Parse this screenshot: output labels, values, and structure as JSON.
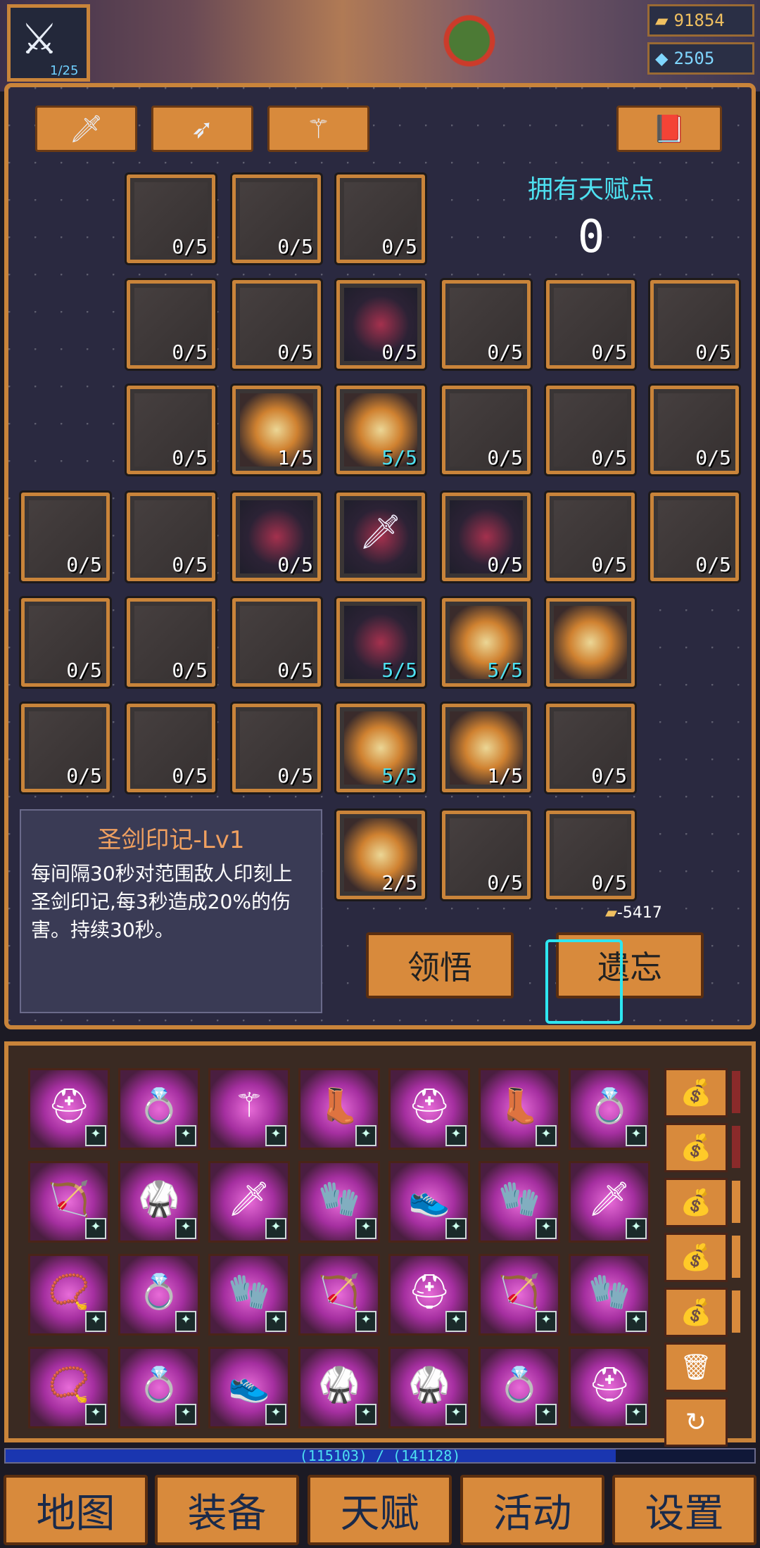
{
  "header": {
    "level_text": "1/25",
    "gold": "91854",
    "gems": "2505",
    "icons": {
      "gold": "gold-bars-icon",
      "gem": "diamond-icon",
      "avatar": "sword-avatar-icon",
      "boss": "boss-portrait-icon"
    }
  },
  "talent": {
    "weapon_tabs": [
      {
        "name": "sword-tab",
        "icon": "sword-icon"
      },
      {
        "name": "bow-tab",
        "icon": "bow-icon"
      },
      {
        "name": "staff-tab",
        "icon": "staff-icon"
      }
    ],
    "book_button_icon": "spellbook-icon",
    "points_label": "拥有天赋点",
    "points_value": "0",
    "nodes": [
      {
        "count": "0/5"
      },
      {
        "count": "0/5"
      },
      {
        "count": "0/5"
      },
      {
        "count": "0/5"
      },
      {
        "count": "0/5"
      },
      {
        "count": "0/5"
      },
      {
        "count": "0/5"
      },
      {
        "count": "0/5"
      },
      {
        "count": "0/5"
      },
      {
        "count": "0/5"
      },
      {
        "count": "1/5"
      },
      {
        "count": "5/5"
      },
      {
        "count": "0/5"
      },
      {
        "count": "0/5"
      },
      {
        "count": "0/5"
      },
      {
        "count": "0/5"
      },
      {
        "count": "0/5"
      },
      {
        "count": "0/5"
      },
      {
        "count": "",
        "icon": "sword"
      },
      {
        "count": "0/5"
      },
      {
        "count": "0/5"
      },
      {
        "count": "0/5"
      },
      {
        "count": "0/5"
      },
      {
        "count": "0/5"
      },
      {
        "count": "0/5"
      },
      {
        "count": "5/5"
      },
      {
        "count": "5/5"
      },
      {
        "count": ""
      },
      {
        "count": "0/5"
      },
      {
        "count": "0/5"
      },
      {
        "count": "0/5"
      },
      {
        "count": "5/5"
      },
      {
        "count": "1/5"
      },
      {
        "count": "0/5"
      },
      {
        "count": "2/5"
      },
      {
        "count": "0/5"
      },
      {
        "count": "0/5"
      }
    ],
    "description": {
      "title": "圣剑印记-Lv1",
      "text": "每间隔30秒对范围敌人印刻上圣剑印记,每3秒造成20%的伤害。持续30秒。"
    },
    "cost": "-5417",
    "learn_label": "领悟",
    "forget_label": "遗忘"
  },
  "inventory": {
    "icons": [
      "golden-helmet-icon",
      "blue-orb-ring-icon",
      "skull-staff-icon",
      "red-boots-icon",
      "golden-helmet-icon",
      "red-boots-icon",
      "silver-ring-icon",
      "crossbow-icon",
      "blue-armor-icon",
      "silver-sword-icon",
      "pink-gloves-icon",
      "white-boots-icon",
      "pink-gloves-icon",
      "silver-sword-icon",
      "pink-amulet-icon",
      "ruby-ring-icon",
      "bronze-gloves-icon",
      "green-bow-icon",
      "silver-helmet-icon",
      "green-bow-icon",
      "bronze-gloves-icon",
      "bronze-amulet-icon",
      "blue-orb-ring-icon",
      "white-boots-icon",
      "silver-armor-icon",
      "pink-armor-icon",
      "blue-orb-ring-icon",
      "golden-helmet-icon"
    ],
    "side_icons": [
      "loot-bag-icon",
      "loot-bag-icon",
      "loot-bag-icon",
      "loot-bag-icon",
      "loot-bag-icon",
      "trash-icon",
      "refresh-icon"
    ],
    "xp_text": "(115103) / (141128)",
    "xp_progress": 0.815
  },
  "nav": {
    "items": [
      "地图",
      "装备",
      "天赋",
      "活动",
      "设置"
    ]
  }
}
